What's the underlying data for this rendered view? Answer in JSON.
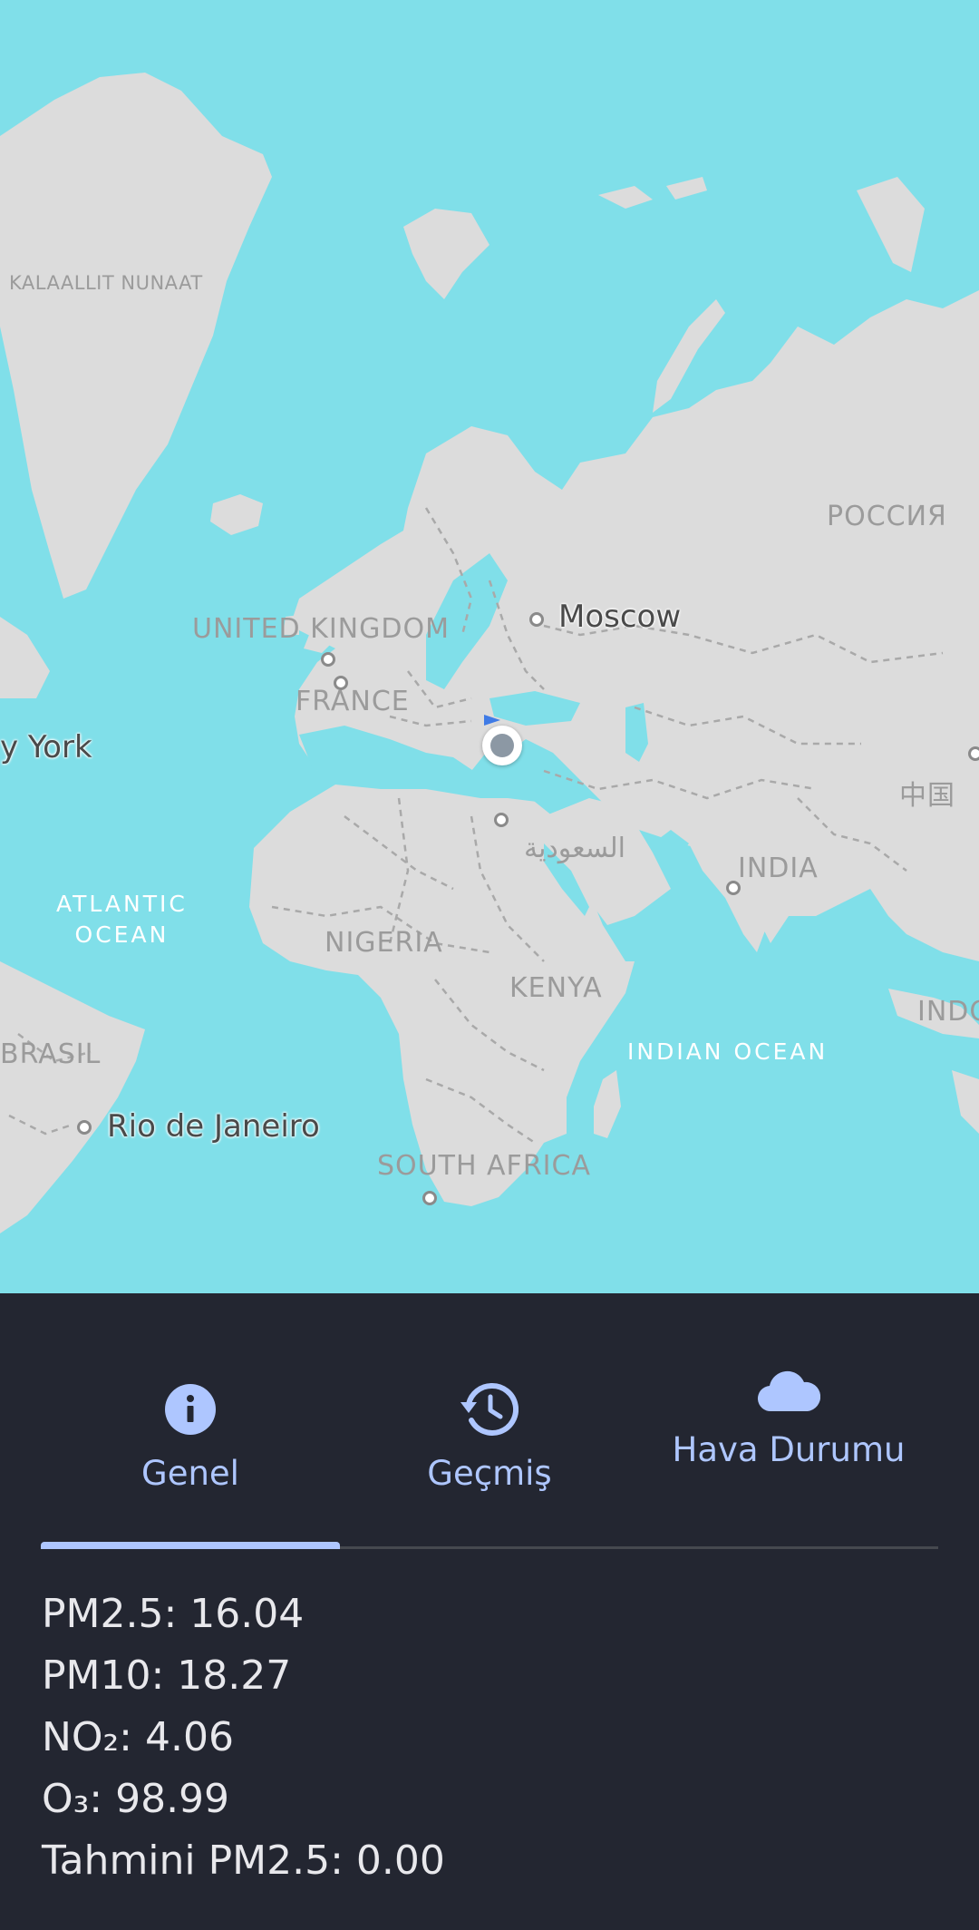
{
  "map": {
    "labels": {
      "greenland": "KALAALLIT NUNAAT",
      "russia": "РОССИЯ",
      "uk": "UNITED KINGDOM",
      "france": "FRANCE",
      "china": "中国",
      "saudi": "السعودية",
      "india": "INDIA",
      "nigeria": "NIGERIA",
      "kenya": "KENYA",
      "brasil": "BRASIL",
      "south_africa": "SOUTH AFRICA",
      "indonesia": "INDO",
      "atlantic": "ATLANTIC\nOCEAN",
      "indian_ocean": "INDIAN OCEAN"
    },
    "cities": {
      "moscow": "Moscow",
      "new_york": "y York",
      "rio": "Rio de Janeiro"
    },
    "colors": {
      "water": "#80dfe9",
      "land": "#dcdcdc"
    }
  },
  "tabs": {
    "general": {
      "label": "Genel",
      "icon": "info-icon"
    },
    "history": {
      "label": "Geçmiş",
      "icon": "history-icon"
    },
    "weather": {
      "label": "Hava Durumu",
      "icon": "cloud-icon"
    },
    "selected": "general"
  },
  "readings": {
    "pm25": "PM2.5: 16.04",
    "pm10": "PM10: 18.27",
    "no2": "NO₂: 4.06",
    "o3": "O₃: 98.99",
    "forecast_pm25": "Tahmini PM2.5: 0.00"
  },
  "colors": {
    "panel": "#232631",
    "accent": "#aec6ff",
    "text": "#e8e8ec"
  }
}
